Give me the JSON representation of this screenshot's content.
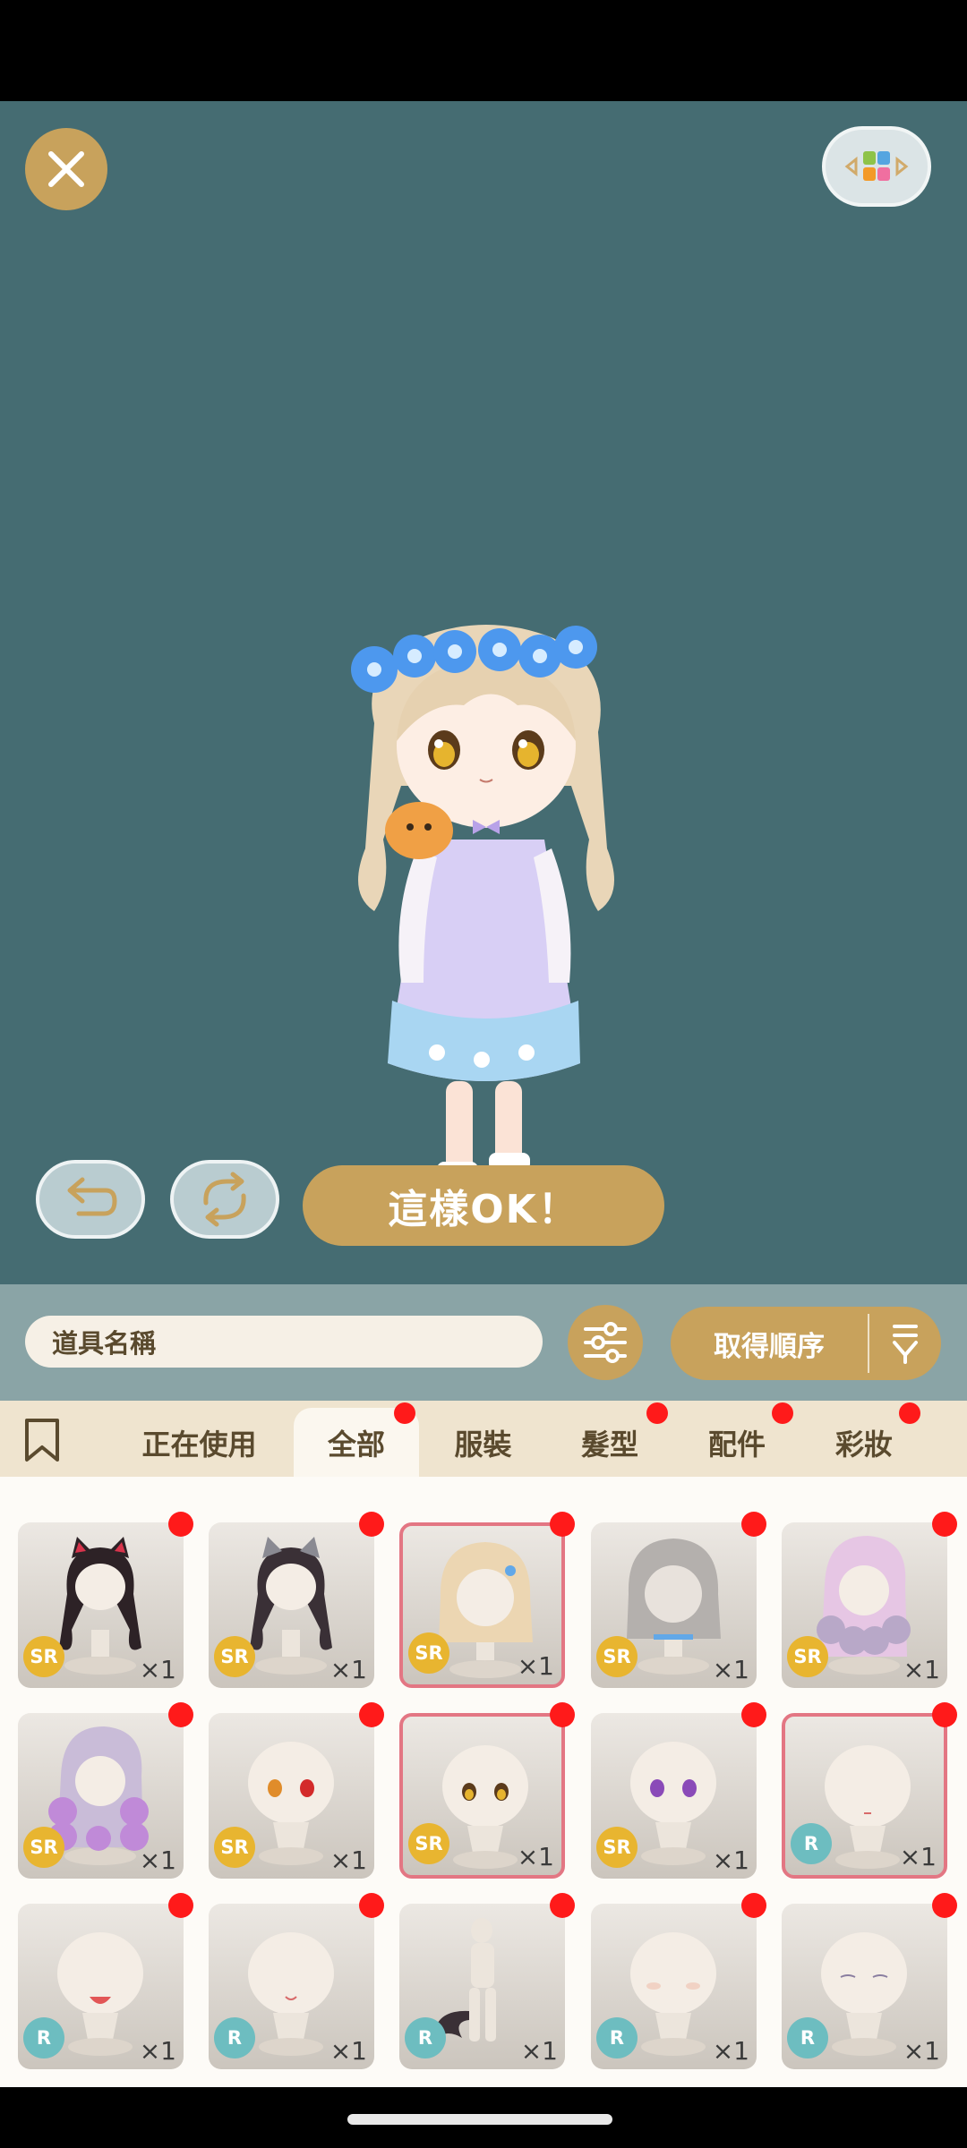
{
  "toolbar": {
    "ok_label": "這樣OK！"
  },
  "search": {
    "placeholder": "道具名稱",
    "sort_label": "取得順序"
  },
  "tabs": [
    {
      "label": "正在使用",
      "active": false,
      "dot": false
    },
    {
      "label": "全部",
      "active": true,
      "dot": true
    },
    {
      "label": "服裝",
      "active": false,
      "dot": false
    },
    {
      "label": "髮型",
      "active": false,
      "dot": true
    },
    {
      "label": "配件",
      "active": false,
      "dot": true
    },
    {
      "label": "彩妝",
      "active": false,
      "dot": true
    }
  ],
  "items": [
    {
      "kind": "cat-ear-hair-black",
      "rarity": "SR",
      "qty": "×1",
      "selected": false
    },
    {
      "kind": "cat-ear-hair-gray",
      "rarity": "SR",
      "qty": "×1",
      "selected": false
    },
    {
      "kind": "long-hair-blonde",
      "rarity": "SR",
      "qty": "×1",
      "selected": true
    },
    {
      "kind": "long-hair-gray",
      "rarity": "SR",
      "qty": "×1",
      "selected": false
    },
    {
      "kind": "curly-hair-pink",
      "rarity": "SR",
      "qty": "×1",
      "selected": false
    },
    {
      "kind": "curly-hair-purple",
      "rarity": "SR",
      "qty": "×1",
      "selected": false
    },
    {
      "kind": "eyes-red-orange",
      "rarity": "SR",
      "qty": "×1",
      "selected": false
    },
    {
      "kind": "eyes-amber",
      "rarity": "SR",
      "qty": "×1",
      "selected": true
    },
    {
      "kind": "eyes-violet",
      "rarity": "SR",
      "qty": "×1",
      "selected": false
    },
    {
      "kind": "mouth-small",
      "rarity": "R",
      "qty": "×1",
      "selected": true
    },
    {
      "kind": "mouth-open",
      "rarity": "R",
      "qty": "×1",
      "selected": false
    },
    {
      "kind": "mouth-smile",
      "rarity": "R",
      "qty": "×1",
      "selected": false
    },
    {
      "kind": "tail-body",
      "rarity": "R",
      "qty": "×1",
      "selected": false
    },
    {
      "kind": "blush",
      "rarity": "R",
      "qty": "×1",
      "selected": false
    },
    {
      "kind": "closed-eyes",
      "rarity": "R",
      "qty": "×1",
      "selected": false
    }
  ],
  "colors": {
    "stage_bg": "#456c72",
    "accent_gold": "#c8a25c",
    "selected_border": "#e37683",
    "notification_dot": "#ff1a1a",
    "rarity_sr": "#e8b530",
    "rarity_r": "#6dbdc0"
  }
}
